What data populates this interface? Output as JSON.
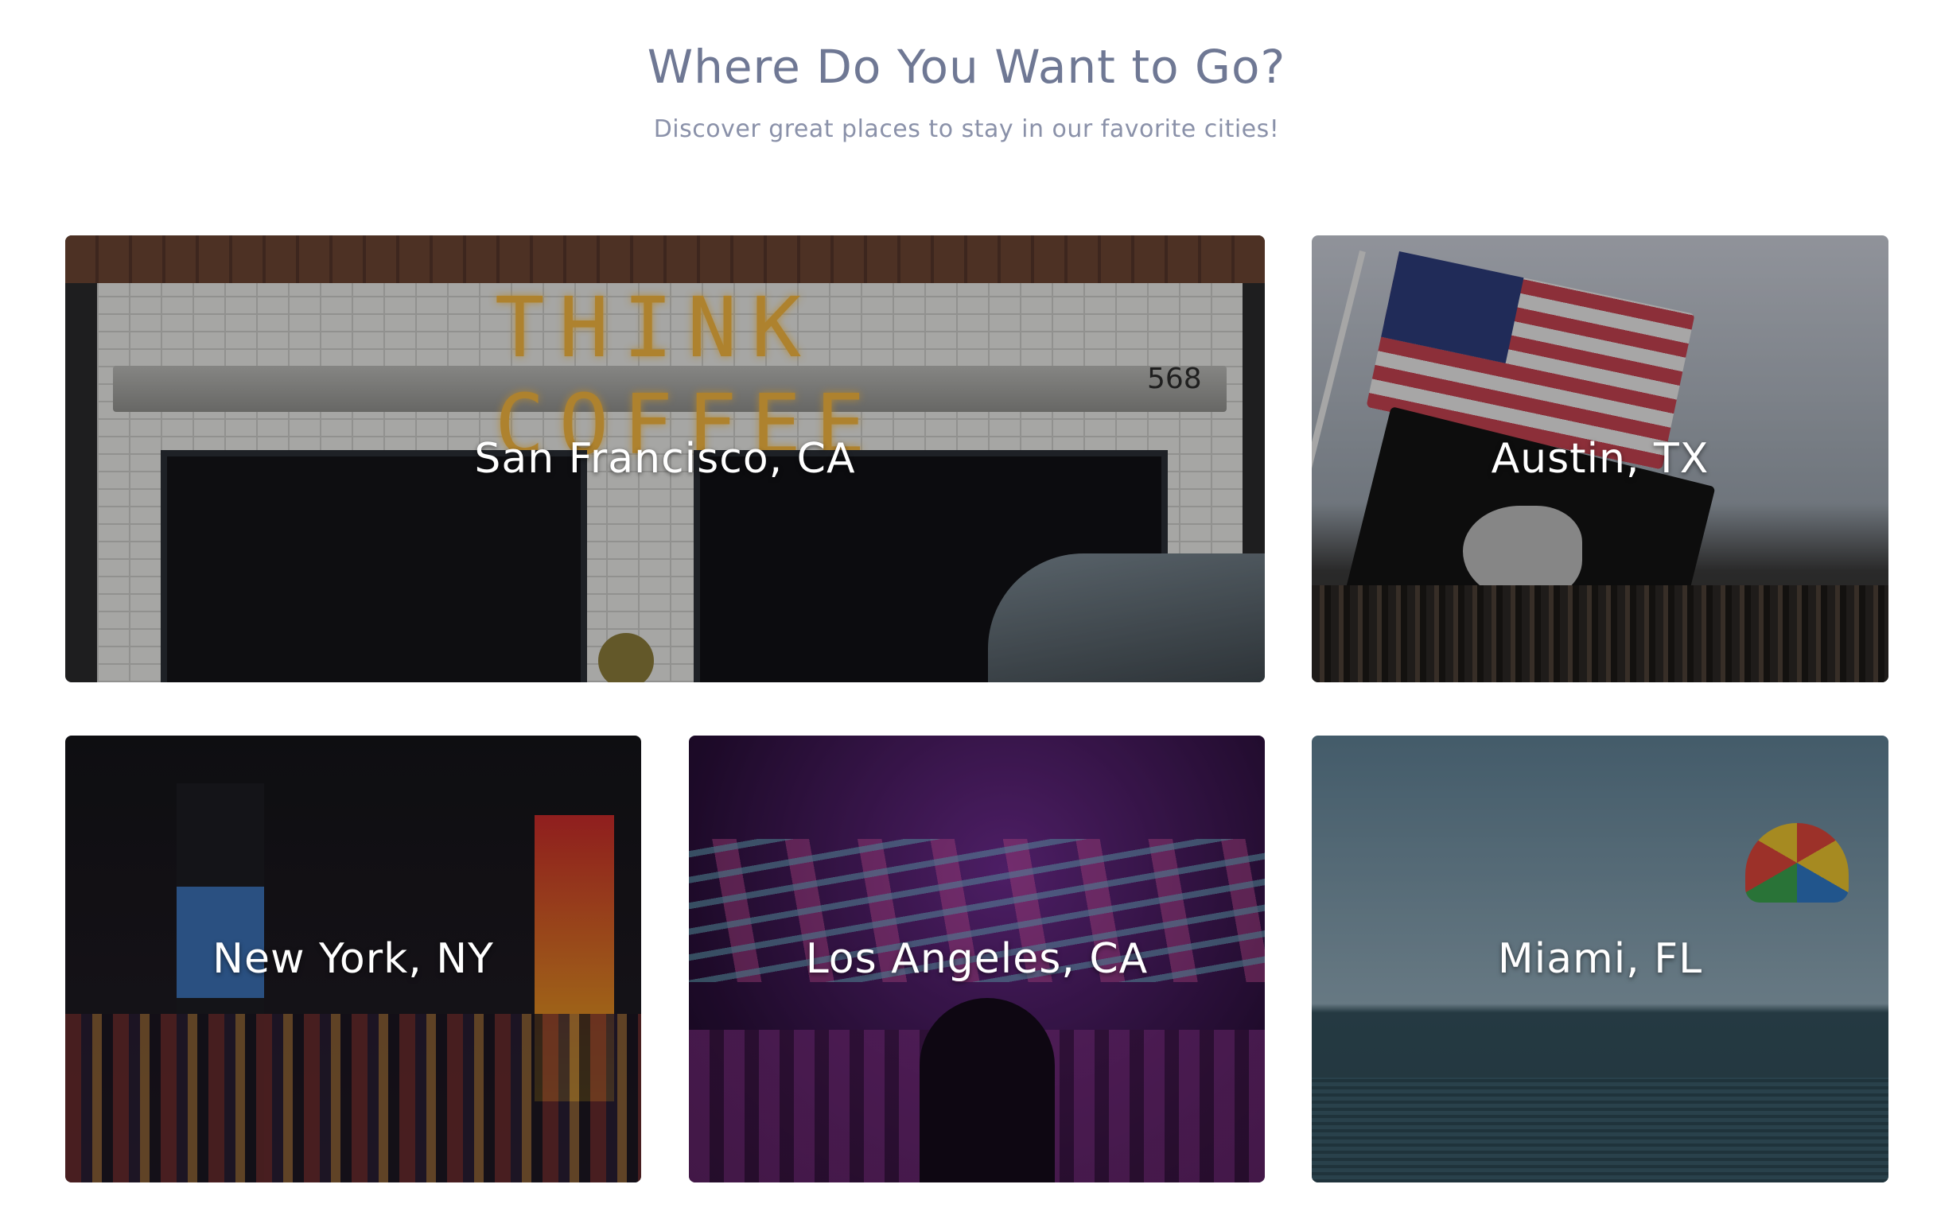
{
  "header": {
    "title": "Where Do You Want to Go?",
    "subtitle": "Discover great places to stay in our favorite cities!"
  },
  "cities": [
    {
      "name": "San Francisco, CA"
    },
    {
      "name": "Austin, TX"
    },
    {
      "name": "New York, NY"
    },
    {
      "name": "Los Angeles, CA"
    },
    {
      "name": "Miami, FL"
    }
  ],
  "images": {
    "sf_sign": "THINK COFFEE",
    "sf_number": "568"
  }
}
